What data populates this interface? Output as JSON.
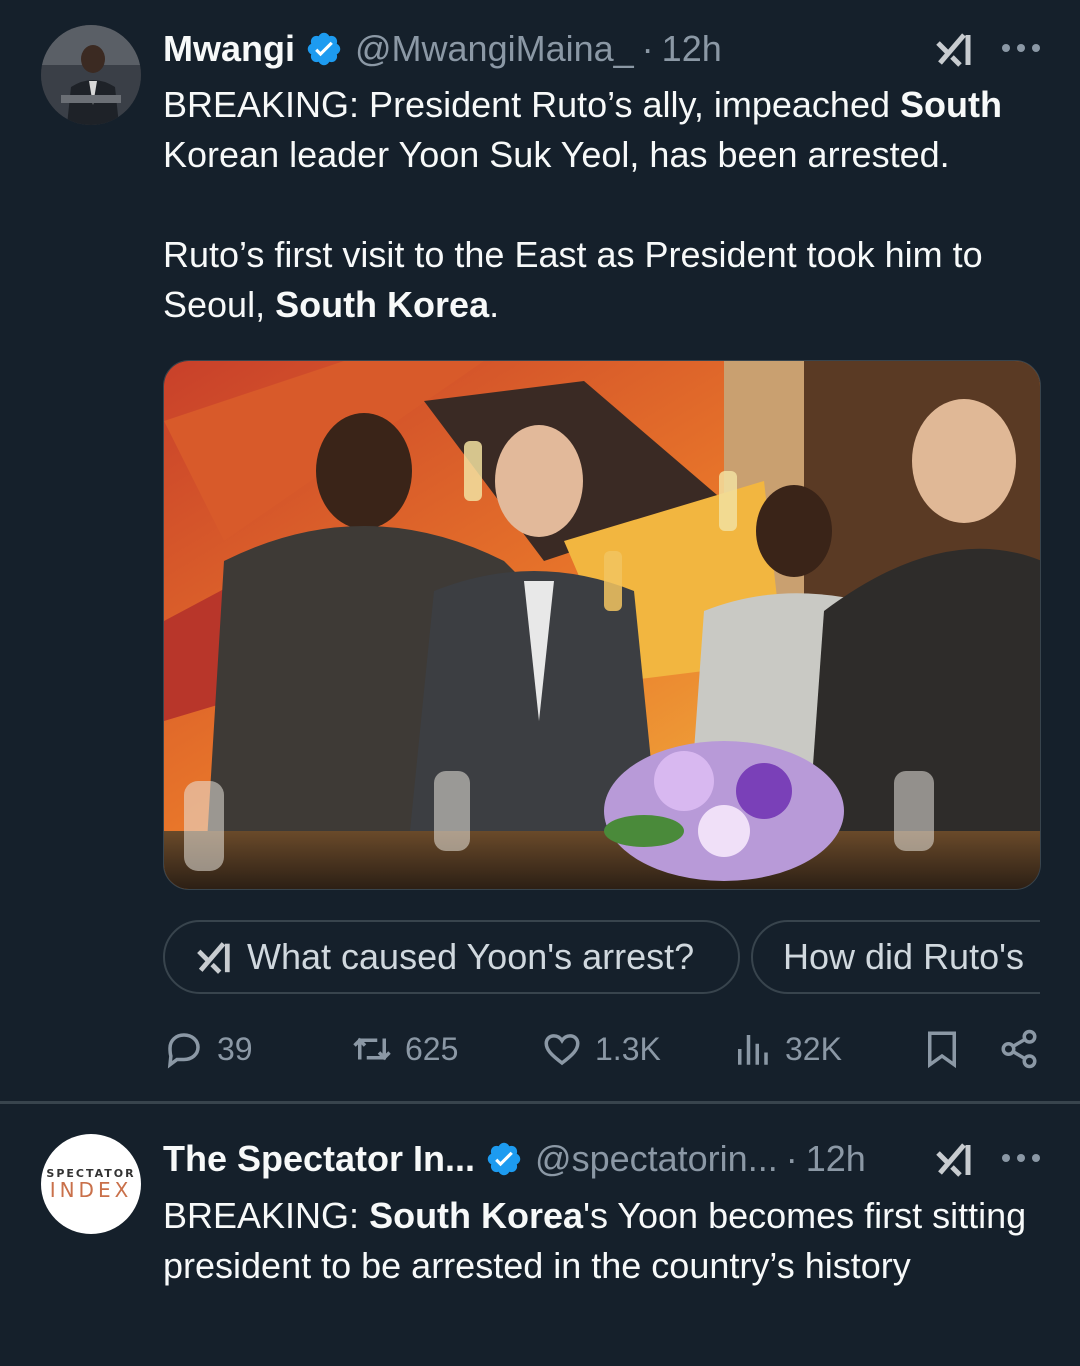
{
  "tweets": [
    {
      "name": "Mwangi",
      "handle": "@MwangiMaina_",
      "separator": "·",
      "time": "12h",
      "text_parts": {
        "p1_a": "BREAKING: President Ruto’s ally, impeached ",
        "p1_b": "South",
        "p1_c": " Korean leader Yoon Suk Yeol, has been arrested.",
        "p2_a": "Ruto’s first visit to the East as President took him to Seoul, ",
        "p2_b": "South Korea",
        "p2_c": "."
      },
      "grok_chips": [
        "What caused Yoon's arrest?",
        "How did Ruto's"
      ],
      "actions": {
        "replies": "39",
        "reposts": "625",
        "likes": "1.3K",
        "views": "32K"
      },
      "icons": [
        "verified-badge-icon",
        "grok-icon",
        "more-icon",
        "reply-icon",
        "repost-icon",
        "like-icon",
        "views-icon",
        "bookmark-icon",
        "share-icon"
      ]
    },
    {
      "name": "The Spectator In...",
      "handle": "@spectatorin...",
      "separator": "·",
      "time": "12h",
      "avatar_top": "SPECTATOR",
      "avatar_bottom": "INDEX",
      "text_parts": {
        "a": "BREAKING: ",
        "b": "South Korea",
        "c": "'s Yoon becomes first sitting president to be arrested in the country’s history"
      }
    }
  ],
  "colors": {
    "background": "#15202b",
    "text": "#f7f9f9",
    "secondary": "#8b98a5",
    "verified": "#1d9bf0",
    "border": "#38444d"
  }
}
